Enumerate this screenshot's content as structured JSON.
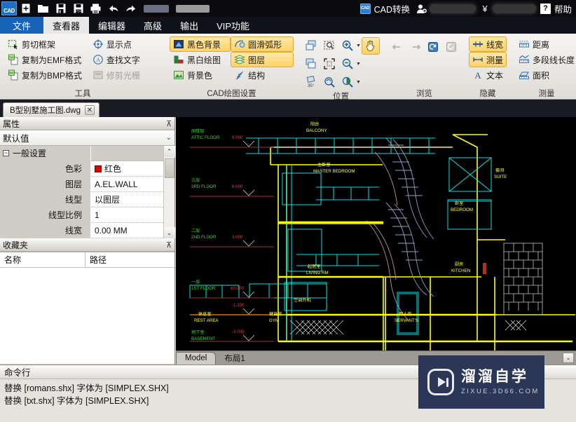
{
  "titlebar": {
    "logo_text": "CAD",
    "quick_access": [
      {
        "name": "new-file-icon",
        "label": "新建"
      },
      {
        "name": "open-folder-icon",
        "label": "打开"
      },
      {
        "name": "save-icon",
        "label": "保存"
      },
      {
        "name": "save-pdf-icon",
        "label": "另存为PDF"
      },
      {
        "name": "print-icon",
        "label": "打印"
      },
      {
        "name": "undo-icon",
        "label": "撤销"
      },
      {
        "name": "redo-icon",
        "label": "重做"
      }
    ],
    "cad_convert_icon": "CAD",
    "cad_convert_label": "CAD转换",
    "user_icon": "user-add-icon",
    "currency_icon": "¥",
    "help_icon": "?",
    "help_label": "帮助"
  },
  "ribbon_tabs": [
    {
      "label": "文件",
      "state": "file"
    },
    {
      "label": "查看器",
      "state": "active"
    },
    {
      "label": "编辑器",
      "state": "normal"
    },
    {
      "label": "高级",
      "state": "normal"
    },
    {
      "label": "输出",
      "state": "normal"
    },
    {
      "label": "VIP功能",
      "state": "normal"
    }
  ],
  "ribbon": {
    "groups": [
      {
        "title": "工具",
        "col1": [
          {
            "label": "剪切框架",
            "icon": "crop-frame-icon",
            "state": "normal"
          },
          {
            "label": "复制为EMF格式",
            "icon": "copy-emf-icon",
            "state": "normal"
          },
          {
            "label": "复制为BMP格式",
            "icon": "copy-bmp-icon",
            "state": "normal"
          }
        ],
        "col2": [
          {
            "label": "显示点",
            "icon": "show-point-icon",
            "state": "normal"
          },
          {
            "label": "查找文字",
            "icon": "find-text-icon",
            "state": "normal"
          },
          {
            "label": "修剪光栅",
            "icon": "trim-raster-icon",
            "state": "disabled"
          }
        ]
      },
      {
        "title": "CAD绘图设置",
        "col1": [
          {
            "label": "黑色背景",
            "icon": "black-background-icon",
            "state": "highlight"
          },
          {
            "label": "黑白绘图",
            "icon": "bw-drawing-icon",
            "state": "normal"
          },
          {
            "label": "背景色",
            "icon": "background-color-icon",
            "state": "normal"
          }
        ],
        "col2": [
          {
            "label": "圆滑弧形",
            "icon": "smooth-arc-icon",
            "state": "highlight"
          },
          {
            "label": "图层",
            "icon": "layers-icon",
            "state": "highlight"
          },
          {
            "label": "结构",
            "icon": "structure-icon",
            "state": "normal"
          }
        ]
      },
      {
        "title": "位置",
        "icons": [
          {
            "name": "zoom-window-icon",
            "state": "normal",
            "caret": false
          },
          {
            "name": "zoom-select-icon",
            "state": "normal",
            "caret": false
          },
          {
            "name": "zoom-in-icon",
            "state": "normal",
            "caret": true
          },
          {
            "name": "pan-hand-icon",
            "state": "highlight",
            "caret": false
          },
          {
            "name": "zoom-previous-icon",
            "state": "normal",
            "caret": false
          },
          {
            "name": "zoom-extents-icon",
            "state": "normal",
            "caret": false
          },
          {
            "name": "zoom-out-icon",
            "state": "normal",
            "caret": true
          },
          {
            "name": "rotate-35-icon",
            "state": "normal",
            "caret": false
          },
          {
            "name": "zoom-realtime-icon",
            "state": "normal",
            "caret": false
          },
          {
            "name": "zoom-dynamic-icon",
            "state": "normal",
            "caret": true
          }
        ]
      },
      {
        "title": "浏览",
        "icons": [
          {
            "name": "back-arrow-icon",
            "state": "disabled",
            "caret": false
          },
          {
            "name": "forward-arrow-icon",
            "state": "disabled",
            "caret": false
          },
          {
            "name": "refresh-view-icon",
            "state": "normal",
            "caret": false
          },
          {
            "name": "restore-view-icon",
            "state": "disabled",
            "caret": false
          }
        ]
      },
      {
        "title": "隐藏",
        "col1": [
          {
            "label": "线宽",
            "icon": "line-width-icon",
            "state": "highlight"
          },
          {
            "label": "测量",
            "icon": "measure-toggle-icon",
            "state": "highlight"
          },
          {
            "label": "文本",
            "icon": "text-a-icon",
            "state": "normal"
          }
        ]
      },
      {
        "title": "测量",
        "col1": [
          {
            "label": "距离",
            "icon": "distance-icon",
            "state": "normal"
          },
          {
            "label": "多段线长度",
            "icon": "polyline-length-icon",
            "state": "normal"
          },
          {
            "label": "面积",
            "icon": "area-icon",
            "state": "normal"
          }
        ]
      }
    ]
  },
  "document_tab": {
    "title": "B型别墅施工图.dwg",
    "close_label": "✕"
  },
  "properties_panel": {
    "header": "属性",
    "pin_icon": "pin-icon",
    "combo_value": "默认值",
    "group_label": "一般设置",
    "rows": [
      {
        "key": "色彩",
        "value": "红色",
        "swatch": "#e00000"
      },
      {
        "key": "图层",
        "value": "A.EL.WALL",
        "swatch": ""
      },
      {
        "key": "线型",
        "value": "以图层",
        "swatch": ""
      },
      {
        "key": "线型比例",
        "value": "1",
        "swatch": ""
      },
      {
        "key": "线宽",
        "value": "0.00 MM",
        "swatch": ""
      }
    ]
  },
  "favorites_panel": {
    "header": "收藏夹",
    "pin_icon": "pin-icon",
    "columns": [
      "名称",
      "路径"
    ],
    "rows": []
  },
  "model_tabs": [
    {
      "label": "Model",
      "state": "active"
    },
    {
      "label": "布局1",
      "state": "normal"
    }
  ],
  "command_line": {
    "header": "命令行",
    "lines": [
      "替换 [romans.shx] 字体为 [SIMPLEX.SHX]",
      "替换 [txt.shx] 字体为 [SIMPLEX.SHX]"
    ]
  },
  "watermark": {
    "cn": "溜溜自学",
    "en": "ZIXUE.3D66.COM"
  },
  "drawing": {
    "background": "#000000",
    "levels": [
      {
        "cn": "阁楼层",
        "en": "ATTIC FLOOR",
        "elev": "9.000"
      },
      {
        "cn": "三层",
        "en": "3RD FLOOR",
        "elev": "6.000"
      },
      {
        "cn": "二层",
        "en": "2ND FLOOR",
        "elev": "3.000"
      },
      {
        "cn": "一层",
        "en": "1ST FLOOR",
        "elev": "±0.000"
      },
      {
        "cn": "",
        "en": "",
        "elev": "-1.200"
      },
      {
        "cn": "地下室",
        "en": "BASEMENT",
        "elev": "-3.000"
      }
    ],
    "rooms": [
      {
        "cn": "阳台",
        "en": "BALCONY"
      },
      {
        "cn": "主卧室",
        "en": "MASTER BEDROOM"
      },
      {
        "cn": "套间",
        "en": "SUITE"
      },
      {
        "cn": "卧室",
        "en": "BEDROOM"
      },
      {
        "cn": "起居室",
        "en": "LIVING RM"
      },
      {
        "cn": "厨房",
        "en": "KITCHEN"
      },
      {
        "cn": "休息室",
        "en": "REST AREA"
      },
      {
        "cn": "健身房",
        "en": "GYM"
      },
      {
        "cn": "佣人房",
        "en": "SERVANT'S"
      },
      {
        "cn": "空调外机",
        "en": ""
      }
    ]
  }
}
